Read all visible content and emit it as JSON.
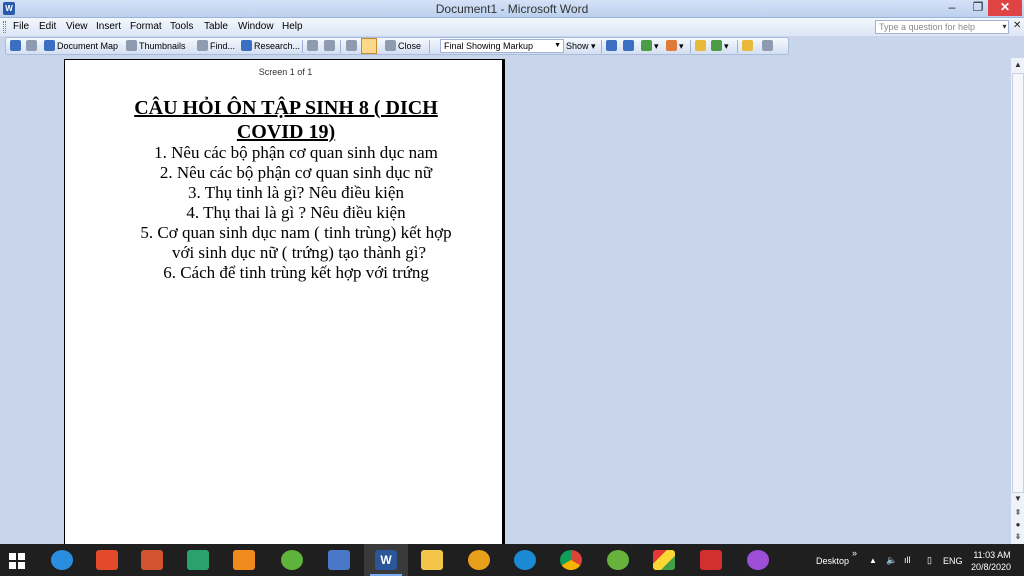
{
  "window": {
    "title": "Document1 - Microsoft Word",
    "app_icon": "W"
  },
  "menu": {
    "items": [
      "File",
      "Edit",
      "View",
      "Insert",
      "Format",
      "Tools",
      "Table",
      "Window",
      "Help"
    ],
    "help_placeholder": "Type a question for help"
  },
  "toolbar": {
    "document_map": "Document Map",
    "thumbnails": "Thumbnails",
    "find": "Find...",
    "research": "Research...",
    "close": "Close",
    "markup_mode": "Final Showing Markup",
    "show": "Show"
  },
  "document": {
    "screen_label": "Screen 1 of 1",
    "title_line1": "CÂU HỎI ÔN TẬP SINH 8 ( DICH",
    "title_line2": "COVID 19)",
    "lines": [
      "1. Nêu các bộ phận cơ quan sinh dục nam",
      "2. Nêu các bộ phận cơ quan sinh dục nữ",
      "3. Thụ tinh là gì? Nêu điều kiện",
      "4. Thụ thai là gì ? Nêu điều kiện",
      "5. Cơ quan sinh dục nam ( tinh trùng)  kết hợp",
      "với sinh dục nữ ( trứng) tạo thành gì?",
      "6. Cách để tinh trùng kết hợp với trứng"
    ]
  },
  "taskbar": {
    "desktop_label": "Desktop",
    "language": "ENG",
    "time": "11:03 AM",
    "date": "20/8/2020",
    "apps": [
      "internet-explorer-icon",
      "grid-app-icon",
      "presentation-app-icon",
      "home-app-icon",
      "media-player-icon",
      "green-leaf-icon",
      "monitor-app-icon",
      "word-icon",
      "file-explorer-icon",
      "chicken-app-icon",
      "edge-icon",
      "chrome-icon",
      "green-leaf-icon-2",
      "color-blocks-icon",
      "kaspersky-icon",
      "flower-app-icon"
    ]
  },
  "colors": {
    "title_gradient_top": "#d5e2f7",
    "workspace": "#c8d5ea",
    "taskbar": "#1f1f1f",
    "close_button": "#e04343"
  }
}
